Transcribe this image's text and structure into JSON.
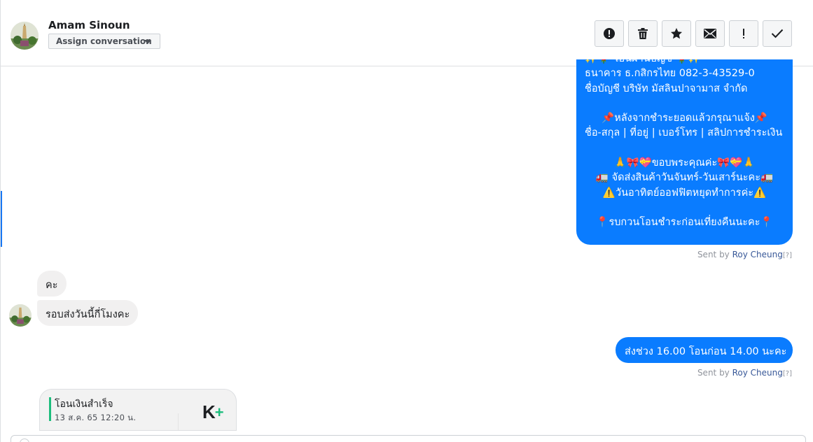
{
  "header": {
    "contact_name": "Amam Sinoun",
    "assign_label": "Assign conversation",
    "tools": [
      {
        "name": "spam-icon",
        "label": "!"
      },
      {
        "name": "trash-icon"
      },
      {
        "name": "star-icon"
      },
      {
        "name": "envelope-icon"
      },
      {
        "name": "follow-up-icon",
        "label": "!"
      },
      {
        "name": "checkmark-icon"
      }
    ]
  },
  "messages": {
    "outgoing_long": {
      "lines": [
        "✨🌹 โอนผ่านบัญชี 🌹✨",
        "ธนาคาร ธ.กสิกรไทย 082-3-43529-0",
        "ชื่อบัญชี บริษัท มัสลินปาจามาส จำกัด",
        "",
        "📌หลังจากชำระยอดแล้วกรุณาแจ้ง📌",
        "ชื่อ-สกุล | ที่อยู่ | เบอร์โทร | สลิปการชำระเงิน",
        "",
        "🙏🎀💝ขอบพระคุณค่ะ🎀💝🙏",
        "🚛 จัดส่งสินค้าวันจันทร์-วันเสาร์นะคะ🚛",
        "⚠️วันอาทิตย์ออฟฟิตหยุดทำการค่ะ⚠️",
        "",
        "📍รบกวนโอนชำระก่อนเที่ยงคืนนะคะ📍"
      ],
      "sent_by_prefix": "Sent by",
      "agent": "Roy Cheung",
      "help": "[?]"
    },
    "incoming": [
      {
        "text": "คะ"
      },
      {
        "text": "รอบส่งวันนี้กี่โมงคะ"
      }
    ],
    "outgoing_short": {
      "text": "ส่งช่วง 16.00 โอนก่อน 14.00 นะคะ",
      "sent_by_prefix": "Sent by",
      "agent": "Roy Cheung",
      "help": "[?]"
    },
    "attachment": {
      "title": "โอนเงินสำเร็จ",
      "date": "13 ส.ค. 65  12:20 น.",
      "logo_text": "K",
      "logo_plus": "+"
    }
  },
  "colors": {
    "outgoing_bubble": "#0a7cff",
    "incoming_bubble": "#f1f0f0",
    "agent_link": "#385898",
    "accent": "#1877f2",
    "kplus_green": "#1dbd7d"
  }
}
